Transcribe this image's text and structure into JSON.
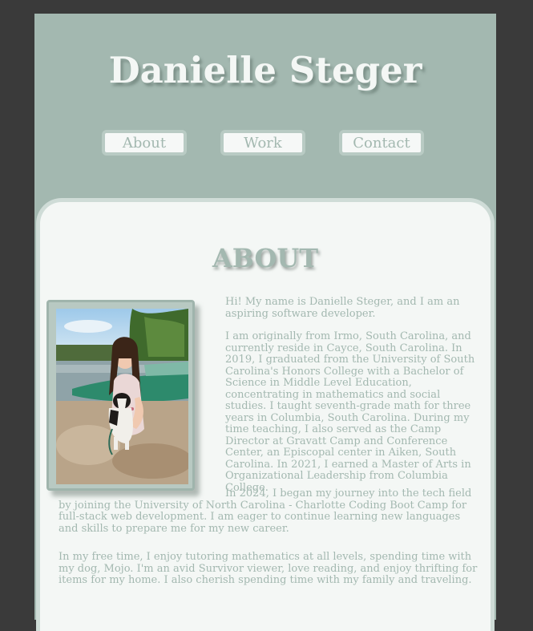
{
  "header": {
    "title": "Danielle Steger"
  },
  "nav": {
    "items": [
      {
        "label": "About"
      },
      {
        "label": "Work"
      },
      {
        "label": "Contact"
      }
    ]
  },
  "about": {
    "heading": "ABOUT",
    "photo_alt": "Danielle kneeling with her dog by a lake",
    "p1": "Hi! My name is Danielle Steger, and I am an aspiring software developer.",
    "p2": "I am originally from Irmo, South Carolina, and currently reside in Cayce, South Carolina. In 2019, I graduated from the University of South Carolina's Honors College with a Bachelor of Science in Middle Level Education, concentrating in mathematics and social studies. I taught seventh-grade math for three years in Columbia, South Carolina. During my time teaching, I also served as the Camp Director at Gravatt Camp and Conference Center, an Episcopal center in Aiken, South Carolina. In 2021, I earned a Master of Arts in Organizational Leadership from Columbia College.",
    "p3": "In 2024, I began my journey into the tech field by joining the University of North Carolina - Charlotte Coding Boot Camp for full-stack web development. I am eager to continue learning new languages and skills to prepare me for my new career.",
    "p4": "In my free time, I enjoy tutoring mathematics at all levels, spending time with my dog, Mojo. I'm an avid Survivor viewer, love reading, and enjoy thrifting for items for my home. I also cherish spending time with my family and traveling."
  },
  "colors": {
    "background": "#3a3a3a",
    "header_bg": "#a3b8b0",
    "content_bg": "#f4f7f5",
    "accent_text": "#a3b8b0"
  }
}
